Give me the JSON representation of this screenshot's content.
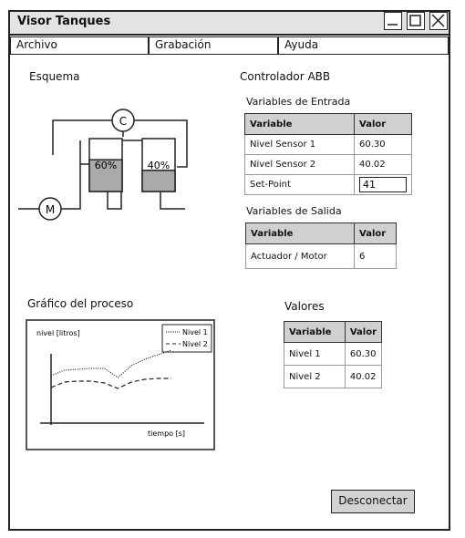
{
  "window": {
    "title": "Visor Tanques"
  },
  "menu": {
    "items": [
      "Archivo",
      "Grabación",
      "Ayuda"
    ]
  },
  "schema": {
    "title": "Esquema",
    "controller_symbol": "C",
    "motor_symbol": "M",
    "tank1": {
      "level_label": "60%",
      "level": 0.6
    },
    "tank2": {
      "level_label": "40%",
      "level": 0.4
    }
  },
  "controller": {
    "title": "Controlador ABB",
    "inputs": {
      "title": "Variables de Entrada",
      "headers": [
        "Variable",
        "Valor"
      ],
      "rows": [
        {
          "variable": "Nivel Sensor 1",
          "valor": "60.30"
        },
        {
          "variable": "Nivel Sensor 2",
          "valor": "40.02"
        }
      ],
      "setpoint": {
        "label": "Set-Point",
        "value": "41"
      }
    },
    "outputs": {
      "title": "Variables de Salida",
      "headers": [
        "Variable",
        "Valor"
      ],
      "rows": [
        {
          "variable": "Actuador / Motor",
          "valor": "6"
        }
      ]
    }
  },
  "process_chart": {
    "title": "Gráfico del proceso",
    "chart_data": {
      "type": "line",
      "ylabel": "nivel [litros]",
      "xlabel": "tiempo [s]",
      "legend": "top-right",
      "series": [
        {
          "name": "Nivel 1",
          "style": "dotted",
          "points": [
            [
              0,
              5.2
            ],
            [
              1,
              5.8
            ],
            [
              2,
              5.9
            ],
            [
              3,
              6.0
            ],
            [
              4,
              6.0
            ],
            [
              5,
              5.0
            ],
            [
              6,
              6.3
            ],
            [
              7,
              7.0
            ],
            [
              8,
              7.5
            ],
            [
              9,
              8.0
            ]
          ]
        },
        {
          "name": "Nivel 2",
          "style": "dashed",
          "points": [
            [
              0,
              3.9
            ],
            [
              1,
              4.5
            ],
            [
              2,
              4.6
            ],
            [
              3,
              4.6
            ],
            [
              4,
              4.4
            ],
            [
              5,
              3.8
            ],
            [
              6,
              4.5
            ],
            [
              7,
              4.8
            ],
            [
              8,
              4.9
            ],
            [
              9,
              4.9
            ]
          ]
        }
      ],
      "ylim": [
        0,
        10
      ],
      "xlim": [
        0,
        9
      ]
    }
  },
  "values": {
    "title": "Valores",
    "headers": [
      "Variable",
      "Valor"
    ],
    "rows": [
      {
        "variable": "Nivel 1",
        "valor": "60.30"
      },
      {
        "variable": "Nivel 2",
        "valor": "40.02"
      }
    ]
  },
  "actions": {
    "disconnect_label": "Desconectar"
  }
}
